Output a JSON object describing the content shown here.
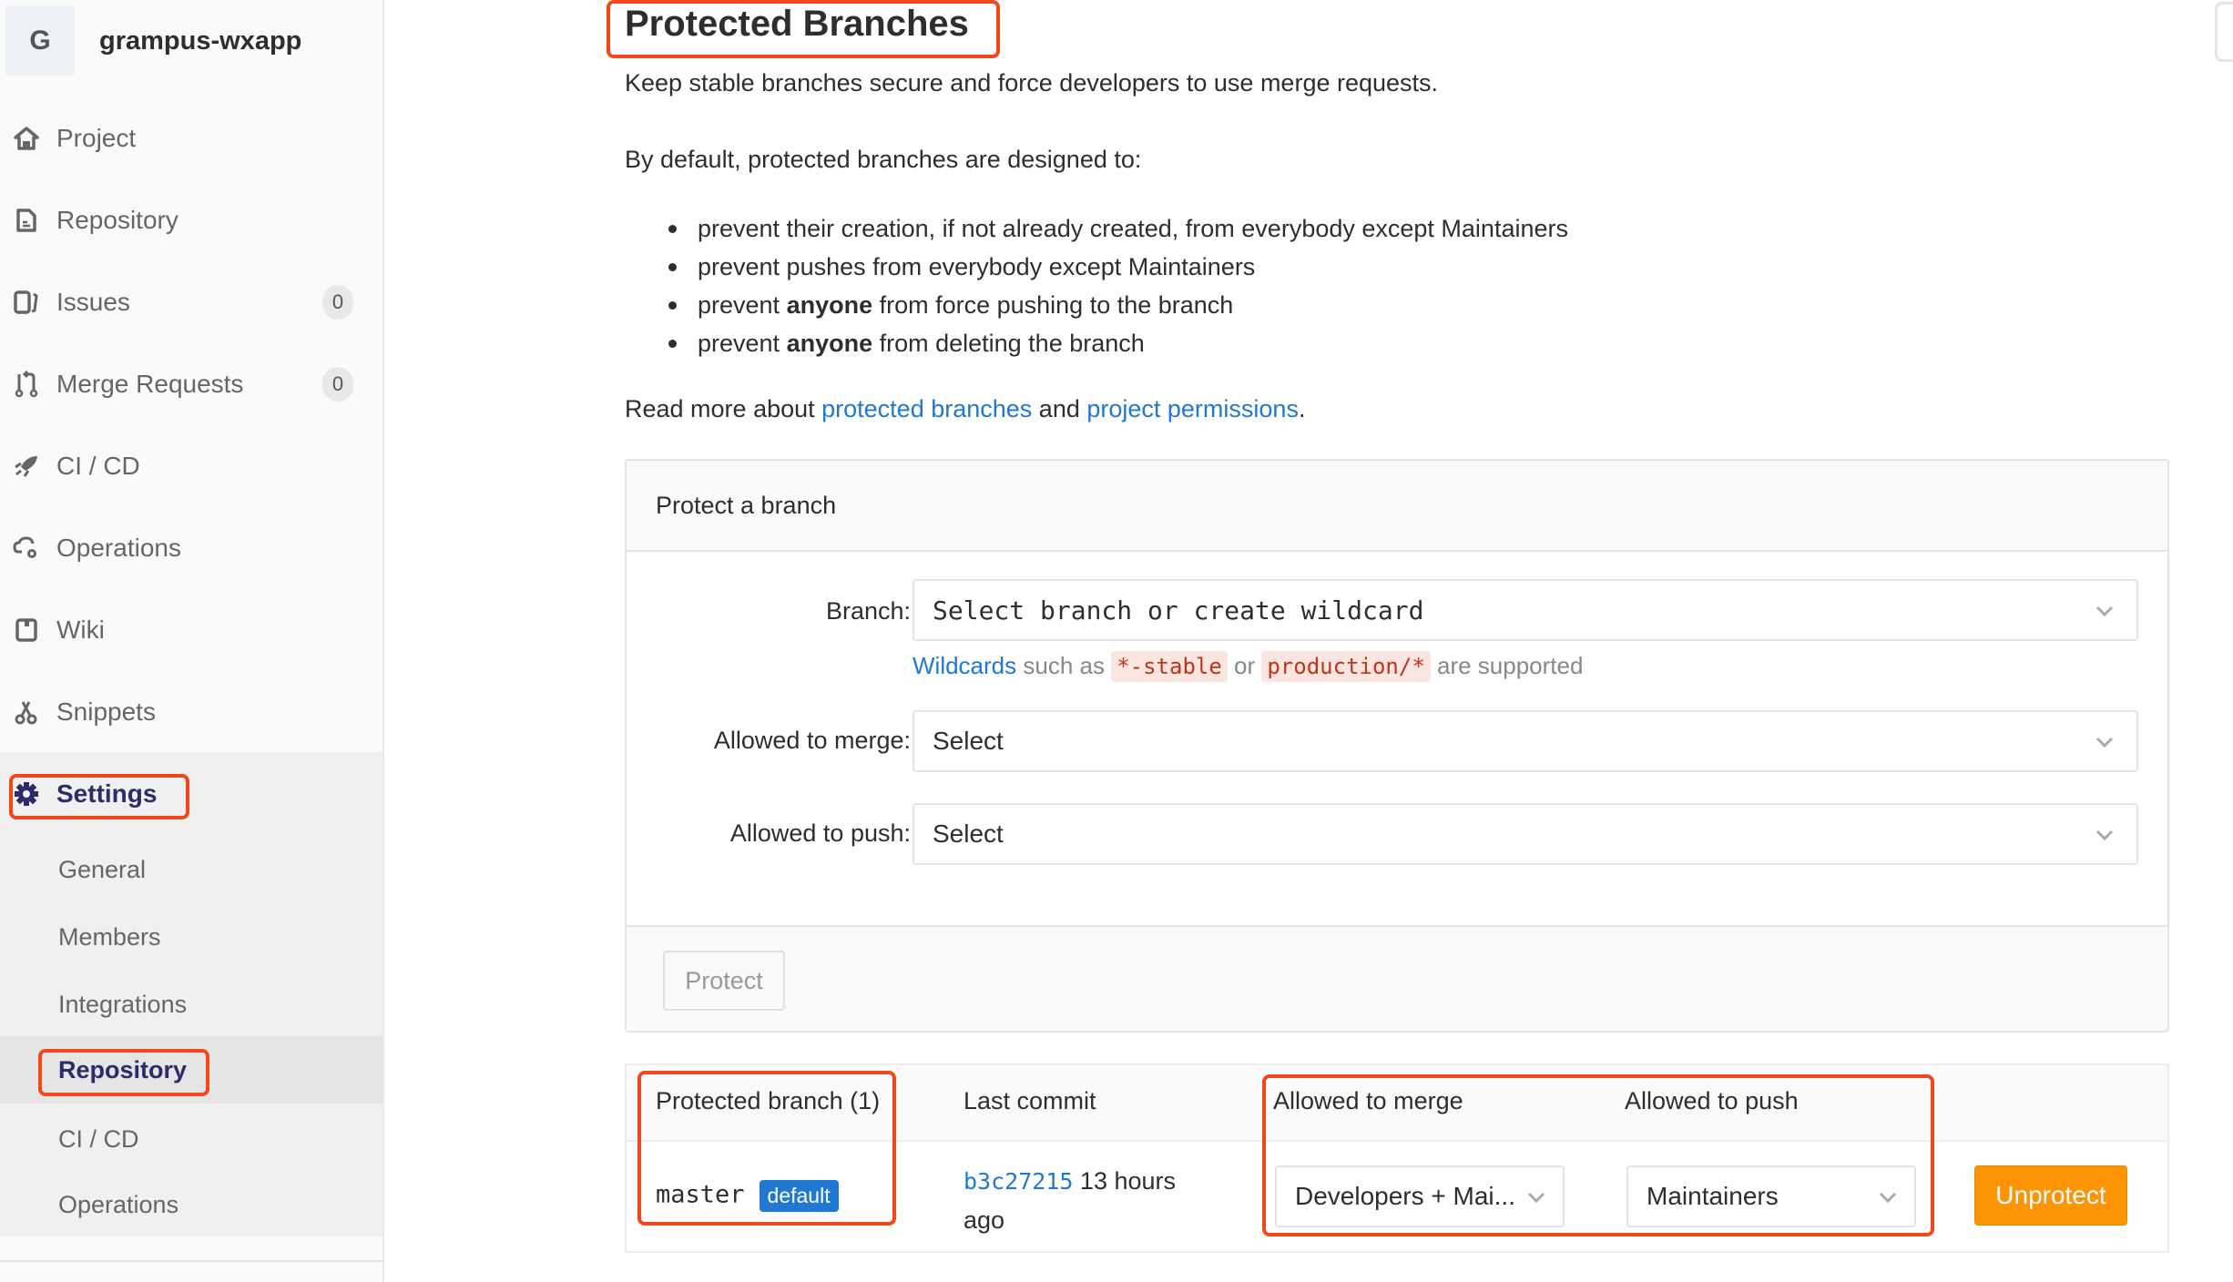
{
  "project": {
    "avatar_letter": "G",
    "name": "grampus-wxapp"
  },
  "sidebar": {
    "items": [
      {
        "label": "Project",
        "icon": "home-icon"
      },
      {
        "label": "Repository",
        "icon": "document-icon"
      },
      {
        "label": "Issues",
        "icon": "issues-icon",
        "count": "0"
      },
      {
        "label": "Merge Requests",
        "icon": "merge-request-icon",
        "count": "0"
      },
      {
        "label": "CI / CD",
        "icon": "rocket-icon"
      },
      {
        "label": "Operations",
        "icon": "cloud-gear-icon"
      },
      {
        "label": "Wiki",
        "icon": "book-icon"
      },
      {
        "label": "Snippets",
        "icon": "scissors-icon"
      },
      {
        "label": "Settings",
        "icon": "gear-icon",
        "active": true
      }
    ],
    "settings_sub": [
      {
        "label": "General"
      },
      {
        "label": "Members"
      },
      {
        "label": "Integrations"
      },
      {
        "label": "Repository",
        "active": true
      },
      {
        "label": "CI / CD"
      },
      {
        "label": "Operations"
      }
    ]
  },
  "main": {
    "title": "Protected Branches",
    "intro": "Keep stable branches secure and force developers to use merge requests.",
    "default_heading": "By default, protected branches are designed to:",
    "bullets": [
      {
        "pre": "prevent their creation, if not already created, from everybody except Maintainers",
        "bold": "",
        "post": ""
      },
      {
        "pre": "prevent pushes from everybody except Maintainers",
        "bold": "",
        "post": ""
      },
      {
        "pre": "prevent ",
        "bold": "anyone",
        "post": " from force pushing to the branch"
      },
      {
        "pre": "prevent ",
        "bold": "anyone",
        "post": " from deleting the branch"
      }
    ],
    "read_more": {
      "prefix": "Read more about ",
      "link1": "protected branches",
      "middle": " and ",
      "link2": "project permissions",
      "suffix": "."
    }
  },
  "protect_form": {
    "heading": "Protect a branch",
    "branch_label": "Branch:",
    "branch_placeholder": "Select branch or create wildcard",
    "hint_link": "Wildcards",
    "hint_text1": " such as ",
    "hint_code1": "*-stable",
    "hint_text2": " or ",
    "hint_code2": "production/*",
    "hint_text3": " are supported",
    "merge_label": "Allowed to merge:",
    "merge_value": "Select",
    "push_label": "Allowed to push:",
    "push_value": "Select",
    "protect_button": "Protect"
  },
  "table": {
    "headers": [
      "Protected branch (1)",
      "Last commit",
      "Allowed to merge",
      "Allowed to push"
    ],
    "rows": [
      {
        "branch": "master",
        "badge": "default",
        "commit_sha": "b3c27215",
        "commit_time_1": " 13 hours",
        "commit_time_2": "ago",
        "merge": "Developers + Mai...",
        "push": "Maintainers",
        "action": "Unprotect"
      }
    ]
  },
  "colors": {
    "accent_link": "#1f78d1",
    "active_nav": "#2f2a6b",
    "unprotect": "#fc9403",
    "annotation": "#f2461b"
  }
}
